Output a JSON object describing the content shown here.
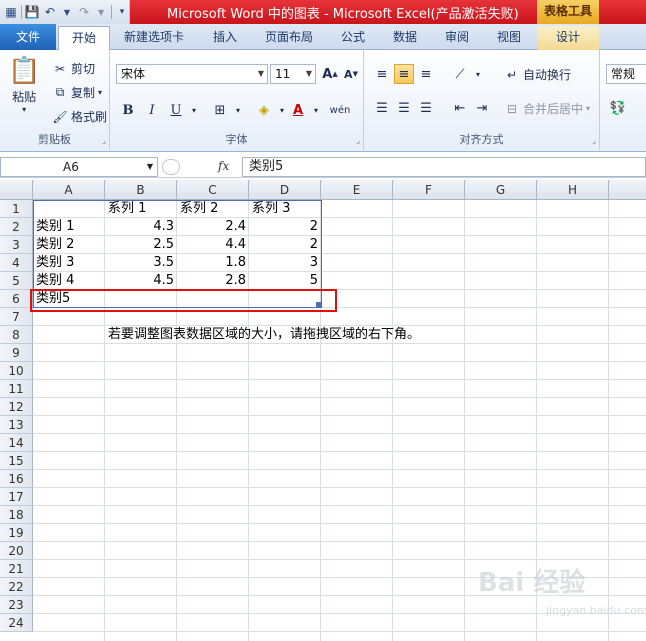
{
  "titlebar": {
    "title": "Microsoft Word 中的图表 - Microsoft Excel(产品激活失败)",
    "context_tab": "表格工具"
  },
  "tabs": [
    "文件",
    "开始",
    "新建选项卡",
    "插入",
    "页面布局",
    "公式",
    "数据",
    "审阅",
    "视图",
    "设计"
  ],
  "clipboard": {
    "paste": "粘贴",
    "cut": "剪切",
    "copy": "复制",
    "format_painter": "格式刷",
    "label": "剪贴板"
  },
  "font": {
    "name": "宋体",
    "size": "11",
    "bold": "B",
    "italic": "I",
    "underline": "U",
    "label": "字体"
  },
  "alignment": {
    "wrap": "自动换行",
    "merge": "合并后居中",
    "label": "对齐方式"
  },
  "number": {
    "format": "常规"
  },
  "formula_bar": {
    "name_box": "A6",
    "fx": "fx",
    "value": "类别5"
  },
  "columns": [
    "A",
    "B",
    "C",
    "D",
    "E",
    "F",
    "G",
    "H"
  ],
  "rows": [
    "1",
    "2",
    "3",
    "4",
    "5",
    "6",
    "7",
    "8",
    "9",
    "10",
    "11",
    "12",
    "13",
    "14",
    "15",
    "16",
    "17",
    "18",
    "19",
    "20",
    "21",
    "22",
    "23",
    "24"
  ],
  "cells": {
    "header": [
      "",
      "系列 1",
      "系列 2",
      "系列 3"
    ],
    "data": [
      [
        "类别 1",
        "4.3",
        "2.4",
        "2"
      ],
      [
        "类别 2",
        "2.5",
        "4.4",
        "2"
      ],
      [
        "类别 3",
        "3.5",
        "1.8",
        "3"
      ],
      [
        "类别 4",
        "4.5",
        "2.8",
        "5"
      ],
      [
        "类别5",
        "",
        "",
        ""
      ]
    ],
    "note": "若要调整图表数据区域的大小，请拖拽区域的右下角。"
  },
  "watermark": "Bai 经验",
  "watermark_sub": "jingyan.baidu.com"
}
